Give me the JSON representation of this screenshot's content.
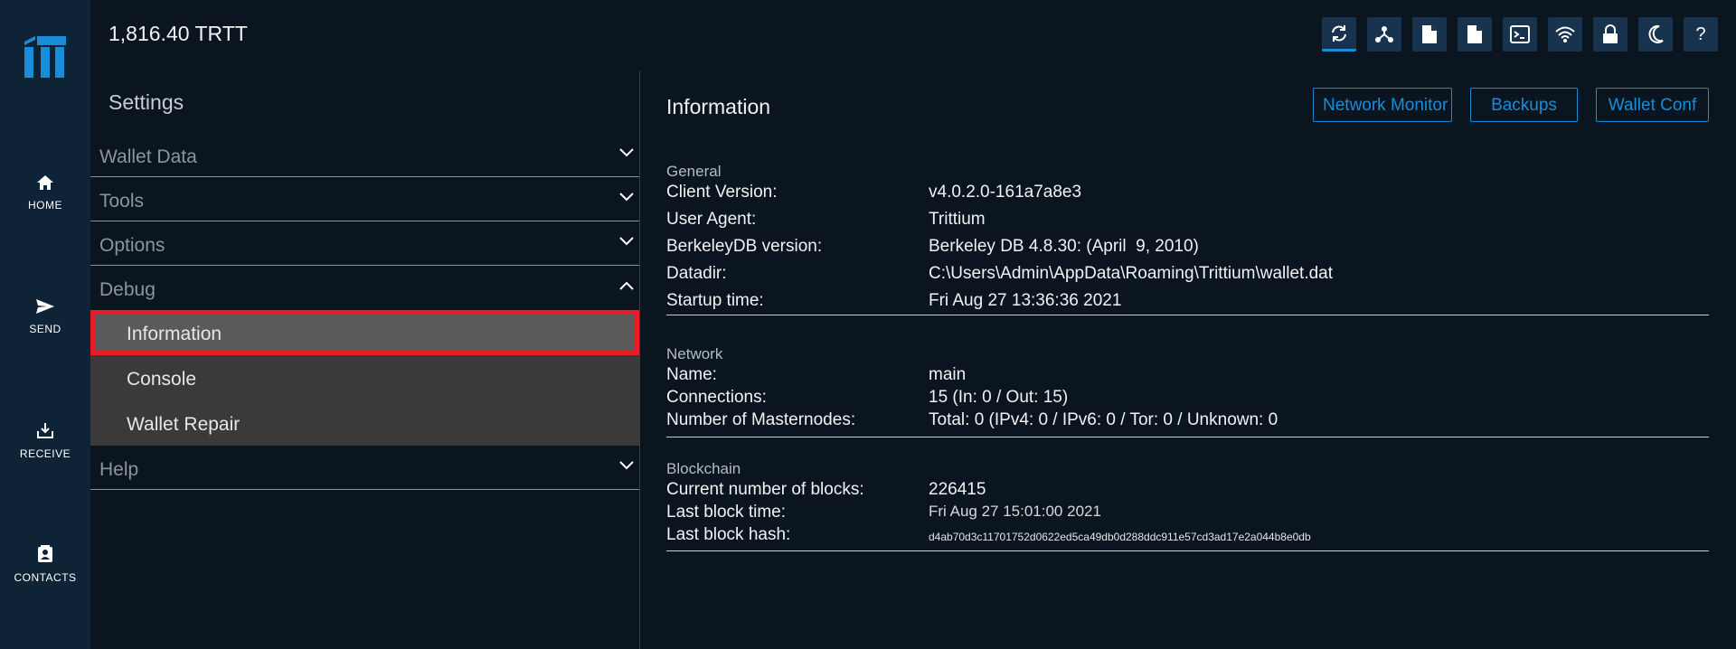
{
  "app": {
    "balance": "1,816.40 TRTT"
  },
  "nav": {
    "home": "HOME",
    "send": "SEND",
    "receive": "RECEIVE",
    "contacts": "CONTACTS"
  },
  "toolbar": {
    "icons": [
      "sync-icon",
      "network-icon",
      "file-icon",
      "file-icon",
      "terminal-icon",
      "wifi-icon",
      "lock-icon",
      "moon-icon",
      "help-icon"
    ],
    "help_label": "?"
  },
  "settings": {
    "title": "Settings",
    "sections": {
      "wallet_data": "Wallet Data",
      "tools": "Tools",
      "options": "Options",
      "debug": "Debug",
      "help": "Help"
    },
    "debug_items": {
      "information": "Information",
      "console": "Console",
      "wallet_repair": "Wallet Repair"
    }
  },
  "content": {
    "title": "Information",
    "buttons": {
      "network_monitor": "Network Monitor",
      "backups": "Backups",
      "wallet_conf": "Wallet Conf"
    },
    "general": {
      "title": "General",
      "client_version_label": "Client Version:",
      "client_version": "v4.0.2.0-161a7a8e3",
      "user_agent_label": "User Agent:",
      "user_agent": "Trittium",
      "berkeleydb_label": "BerkeleyDB version:",
      "berkeleydb": "Berkeley DB 4.8.30: (April  9, 2010)",
      "datadir_label": "Datadir:",
      "datadir": "C:\\Users\\Admin\\AppData\\Roaming\\Trittium\\wallet.dat",
      "startup_label": "Startup time:",
      "startup": "Fri Aug 27 13:36:36 2021"
    },
    "network": {
      "title": "Network",
      "name_label": "Name:",
      "name": "main",
      "connections_label": "Connections:",
      "connections": "15 (In: 0 / Out: 15)",
      "masternodes_label": "Number of Masternodes:",
      "masternodes": "Total: 0 (IPv4: 0 / IPv6: 0 / Tor: 0 / Unknown: 0"
    },
    "blockchain": {
      "title": "Blockchain",
      "blocks_label": "Current number of blocks:",
      "blocks": "226415",
      "last_time_label": "Last block time:",
      "last_time": "Fri Aug 27 15:01:00 2021",
      "last_hash_label": "Last block hash:",
      "last_hash": "d4ab70d3c11701752d0622ed5ca49db0d288ddc911e57cd3ad17e2a044b8e0db"
    }
  },
  "colors": {
    "background": "#0a1520",
    "rail": "#0f2336",
    "accent": "#1a8dd8",
    "selected_outline": "#e81c24"
  }
}
